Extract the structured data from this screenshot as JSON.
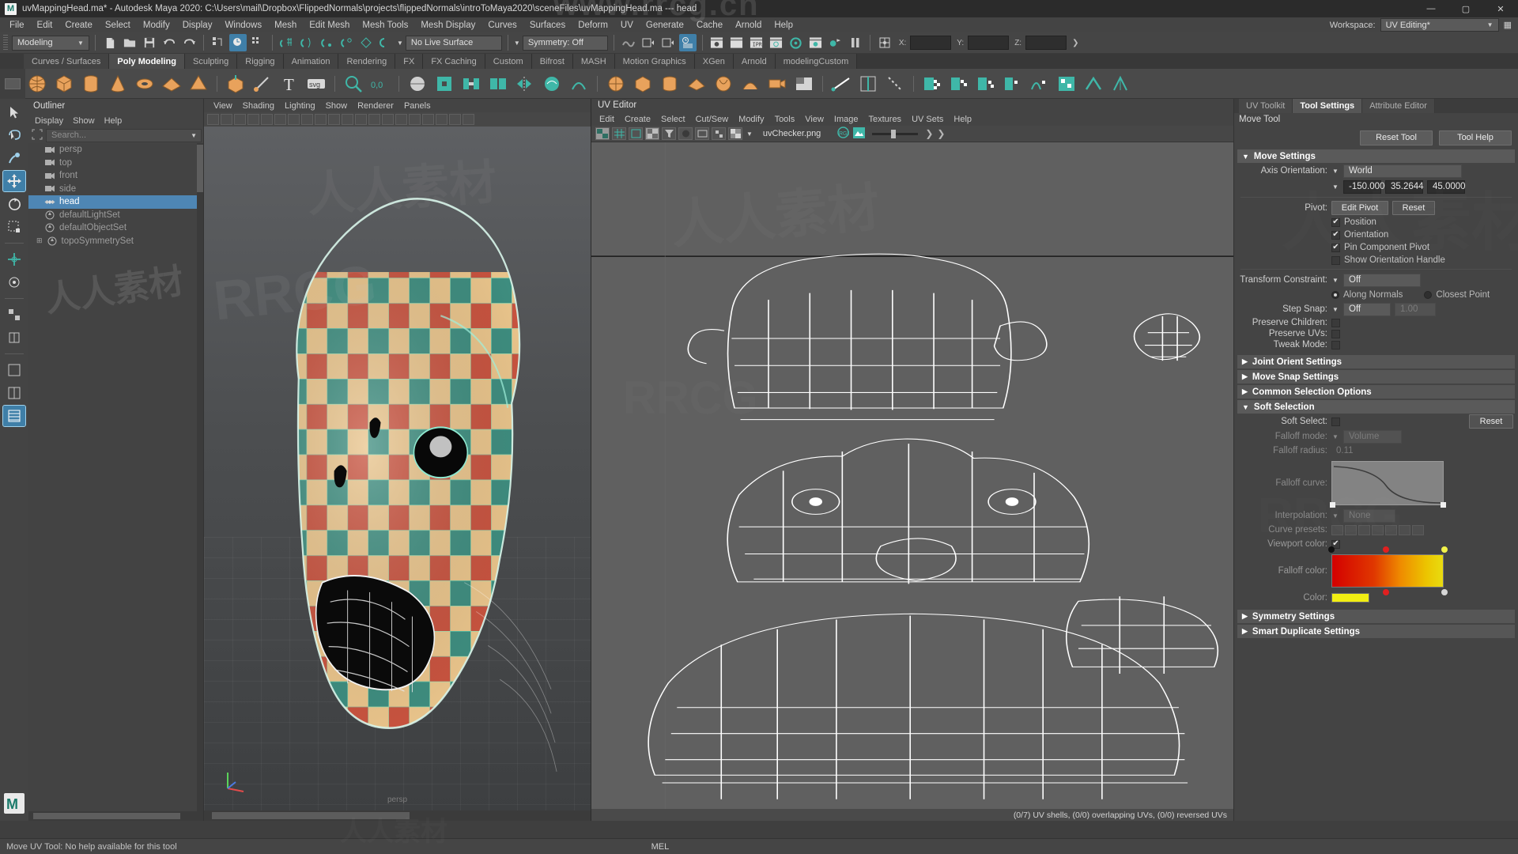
{
  "window": {
    "title": "uvMappingHead.ma* - Autodesk Maya 2020: C:\\Users\\mail\\Dropbox\\FlippedNormals\\projects\\flippedNormals\\introToMaya2020\\sceneFiles\\uvMappingHead.ma  ---  head",
    "logo": "M",
    "minimize": "—",
    "maximize": "▢",
    "close": "✕"
  },
  "menubar": {
    "items": [
      "File",
      "Edit",
      "Create",
      "Select",
      "Modify",
      "Display",
      "Windows",
      "Mesh",
      "Edit Mesh",
      "Mesh Tools",
      "Mesh Display",
      "Curves",
      "Surfaces",
      "Deform",
      "UV",
      "Generate",
      "Cache",
      "Arnold",
      "Help"
    ]
  },
  "statusline": {
    "menu_set": "Modeling",
    "live_surface": "No Live Surface",
    "symmetry": "Symmetry: Off",
    "x_label": "X:",
    "y_label": "Y:",
    "z_label": "Z:",
    "x_value": "",
    "y_value": "",
    "z_value": "",
    "ipr_label": "IPR"
  },
  "shelf": {
    "tabs": [
      "Curves / Surfaces",
      "Poly Modeling",
      "Sculpting",
      "Rigging",
      "Animation",
      "Rendering",
      "FX",
      "FX Caching",
      "Custom",
      "Bifrost",
      "MASH",
      "Motion Graphics",
      "XGen",
      "Arnold",
      "modelingCustom"
    ],
    "active_tab": "Poly Modeling"
  },
  "outliner": {
    "title": "Outliner",
    "menus": [
      "Display",
      "Show",
      "Help"
    ],
    "search_placeholder": "Search...",
    "items": [
      {
        "label": "persp",
        "icon": "camera-icon",
        "selected": false
      },
      {
        "label": "top",
        "icon": "camera-icon",
        "selected": false
      },
      {
        "label": "front",
        "icon": "camera-icon",
        "selected": false
      },
      {
        "label": "side",
        "icon": "camera-icon",
        "selected": false
      },
      {
        "label": "head",
        "icon": "mesh-icon",
        "selected": true
      },
      {
        "label": "defaultLightSet",
        "icon": "set-icon",
        "selected": false
      },
      {
        "label": "defaultObjectSet",
        "icon": "set-icon",
        "selected": false
      },
      {
        "label": "topoSymmetrySet",
        "icon": "set-plus-icon",
        "selected": false
      }
    ]
  },
  "viewport": {
    "menus": [
      "View",
      "Shading",
      "Lighting",
      "Show",
      "Renderer",
      "Panels"
    ],
    "camera_label": "persp"
  },
  "uv_editor": {
    "title": "UV Editor",
    "menus": [
      "Edit",
      "Create",
      "Select",
      "Cut/Sew",
      "Modify",
      "Tools",
      "View",
      "Image",
      "Textures",
      "UV Sets",
      "Help"
    ],
    "texture_name": "uvChecker.png",
    "status": "(0/7) UV shells, (0/0) overlapping UVs, (0/0) reversed UVs"
  },
  "rightdock": {
    "tabs": [
      "UV Toolkit",
      "Tool Settings",
      "Attribute Editor"
    ],
    "active_tab": "Tool Settings",
    "tool_name": "Move Tool",
    "reset_tool": "Reset Tool",
    "tool_help": "Tool Help",
    "move_settings": {
      "header": "Move Settings",
      "axis_orientation_label": "Axis Orientation:",
      "axis_orientation_value": "World",
      "axis_rx": "-150.0000",
      "axis_ry": "35.2644",
      "axis_rz": "45.0000",
      "pivot_label": "Pivot:",
      "edit_pivot": "Edit Pivot",
      "reset": "Reset",
      "checkboxes": [
        {
          "label": "Position",
          "checked": true
        },
        {
          "label": "Orientation",
          "checked": true
        },
        {
          "label": "Pin Component Pivot",
          "checked": true
        },
        {
          "label": "Show Orientation Handle",
          "checked": false
        }
      ],
      "transform_constraint_label": "Transform Constraint:",
      "transform_constraint_value": "Off",
      "along_normals": "Along Normals",
      "along_normals_on": true,
      "closest_point": "Closest Point",
      "closest_point_on": false,
      "step_snap_label": "Step Snap:",
      "step_snap_value": "Off",
      "step_snap_amount": "1.00",
      "preserve_children_label": "Preserve Children:",
      "preserve_children": false,
      "preserve_uvs_label": "Preserve UVs:",
      "preserve_uvs": false,
      "tweak_mode_label": "Tweak Mode:",
      "tweak_mode": false
    },
    "collapsed_frames_1": [
      "Joint Orient Settings",
      "Move Snap Settings",
      "Common Selection Options"
    ],
    "soft_selection": {
      "header": "Soft Selection",
      "soft_select_label": "Soft Select:",
      "soft_select_checked": false,
      "reset": "Reset",
      "falloff_mode_label": "Falloff mode:",
      "falloff_mode_value": "Volume",
      "falloff_radius_label": "Falloff radius:",
      "falloff_radius_value": "0.11",
      "falloff_curve_label": "Falloff curve:",
      "interpolation_label": "Interpolation:",
      "interpolation_value": "None",
      "curve_presets_label": "Curve presets:",
      "viewport_color_label": "Viewport color:",
      "viewport_color_checked": true,
      "falloff_color_label": "Falloff color:",
      "color_label": "Color:",
      "color_value": "#f2ee12"
    },
    "collapsed_frames_2": [
      "Symmetry Settings",
      "Smart Duplicate Settings"
    ]
  },
  "bottom": {
    "help_text": "Move UV Tool: No help available for this tool",
    "mel_label": "MEL"
  },
  "colors": {
    "accent_blue": "#4e86b4",
    "panel_bg": "#444444",
    "dark_bg": "#2e2e2e",
    "teal": "#3fb7a8",
    "highlight": "#3f7fa8"
  },
  "watermarks": {
    "top": "www.rrcg.cn",
    "center": "人人素材",
    "rrcg": "RRCG"
  }
}
